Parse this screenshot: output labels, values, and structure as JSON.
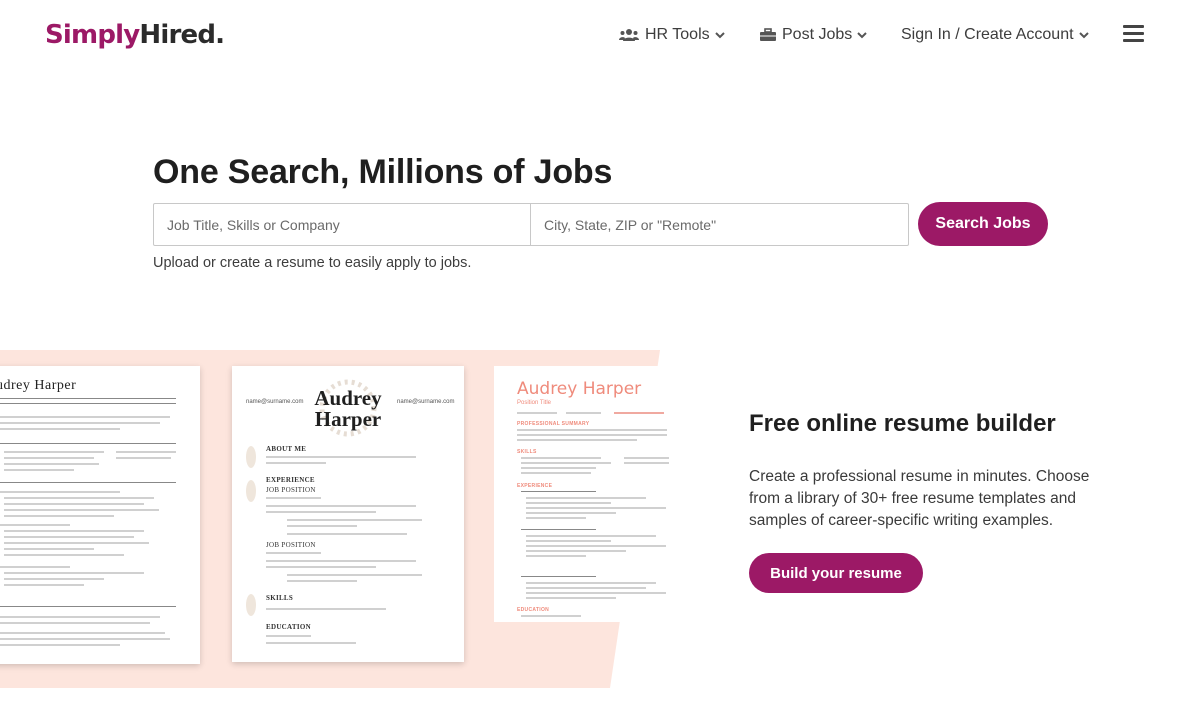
{
  "header": {
    "logo_simply": "Simply",
    "logo_hired": "Hired",
    "logo_dot": ".",
    "nav": {
      "hr_tools": "HR Tools",
      "post_jobs": "Post Jobs",
      "sign_in": "Sign In / Create Account"
    }
  },
  "hero": {
    "title": "One Search, Millions of Jobs",
    "what_placeholder": "Job Title, Skills or Company",
    "where_placeholder": "City, State, ZIP or \"Remote\"",
    "search_button": "Search Jobs",
    "upload_link": "Upload",
    "or": "or",
    "create_link": "create a resume",
    "upload_tail": "to easily apply to jobs."
  },
  "resume_cards": {
    "card1_name": "udrey  Harper",
    "card2_email_left": "name@surname.com",
    "card2_email_right": "name@surname.com",
    "card2_name": "Audrey Harper",
    "card2_about": "ABOUT ME",
    "card2_experience": "EXPERIENCE",
    "card2_job_position": "JOB POSITION",
    "card2_job_position_2": "JOB POSITION",
    "card2_skills": "SKILLS",
    "card2_education": "EDUCATION",
    "card3_name": "Audrey Harper",
    "card3_title": "Position Title",
    "card3_summary": "PROFESSIONAL SUMMARY",
    "card3_skills": "SKILLS",
    "card3_experience": "EXPERIENCE",
    "card3_education": "EDUCATION"
  },
  "promo": {
    "title": "Free online resume builder",
    "description": "Create a professional resume in minutes. Choose from a library of 30+ free resume templates and samples of career-specific writing examples.",
    "button": "Build your resume"
  },
  "colors": {
    "brand": "#9c1966",
    "band": "#fde5dd",
    "accent_pink": "#ef8b7c"
  }
}
